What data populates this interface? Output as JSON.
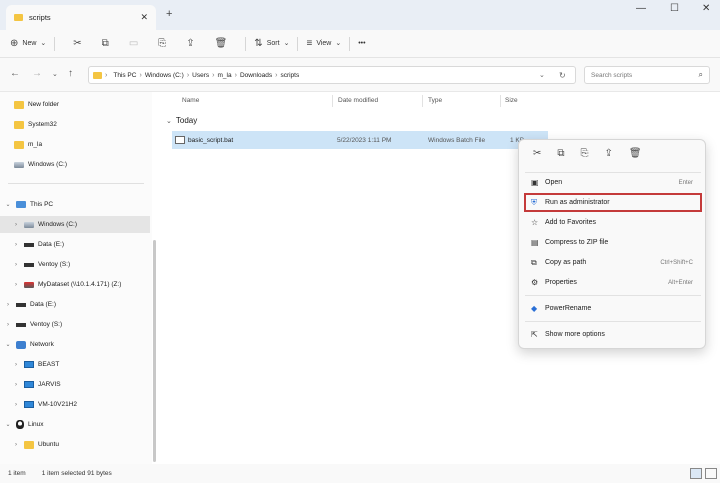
{
  "window": {
    "tab_title": "scripts",
    "tab_close": "✕",
    "new_tab": "+",
    "minimize": "—",
    "maximize": "☐",
    "close": "✕"
  },
  "toolbar": {
    "new_label": "New",
    "sort_label": "Sort",
    "view_label": "View",
    "more_label": "•••"
  },
  "address": {
    "crumbs": [
      "This PC",
      "Windows (C:)",
      "Users",
      "m_la",
      "Downloads",
      "scripts"
    ],
    "search_placeholder": "Search scripts"
  },
  "sidebar": {
    "items": [
      {
        "label": "New folder"
      },
      {
        "label": "System32"
      },
      {
        "label": "m_la"
      },
      {
        "label": "Windows (C:)"
      },
      {
        "label": "This PC"
      },
      {
        "label": "Windows (C:)"
      },
      {
        "label": "Data (E:)"
      },
      {
        "label": "Ventoy (S:)"
      },
      {
        "label": "MyDataset (\\\\10.1.4.171) (Z:)"
      },
      {
        "label": "Data (E:)"
      },
      {
        "label": "Ventoy (S:)"
      },
      {
        "label": "Network"
      },
      {
        "label": "BEAST"
      },
      {
        "label": "JARVIS"
      },
      {
        "label": "VM-10V21H2"
      },
      {
        "label": "Linux"
      },
      {
        "label": "Ubuntu"
      }
    ]
  },
  "columns": {
    "name": "Name",
    "date": "Date modified",
    "type": "Type",
    "size": "Size"
  },
  "group": {
    "label": "Today",
    "chevron": "⌄"
  },
  "file": {
    "name": "basic_script.bat",
    "date": "5/22/2023 1:11 PM",
    "type": "Windows Batch File",
    "size": "1 KB"
  },
  "context_menu": {
    "items": [
      {
        "label": "Open",
        "key": "Enter"
      },
      {
        "label": "Run as administrator",
        "key": ""
      },
      {
        "label": "Add to Favorites",
        "key": ""
      },
      {
        "label": "Compress to ZIP file",
        "key": ""
      },
      {
        "label": "Copy as path",
        "key": "Ctrl+Shift+C"
      },
      {
        "label": "Properties",
        "key": "Alt+Enter"
      },
      {
        "label": "PowerRename",
        "key": ""
      },
      {
        "label": "Show more options",
        "key": ""
      }
    ]
  },
  "status": {
    "count": "1 item",
    "selected": "1 item selected  91 bytes"
  },
  "colors": {
    "accent": "#0067c0",
    "selection": "#cde4f7",
    "highlight_box": "#c43a3a"
  }
}
